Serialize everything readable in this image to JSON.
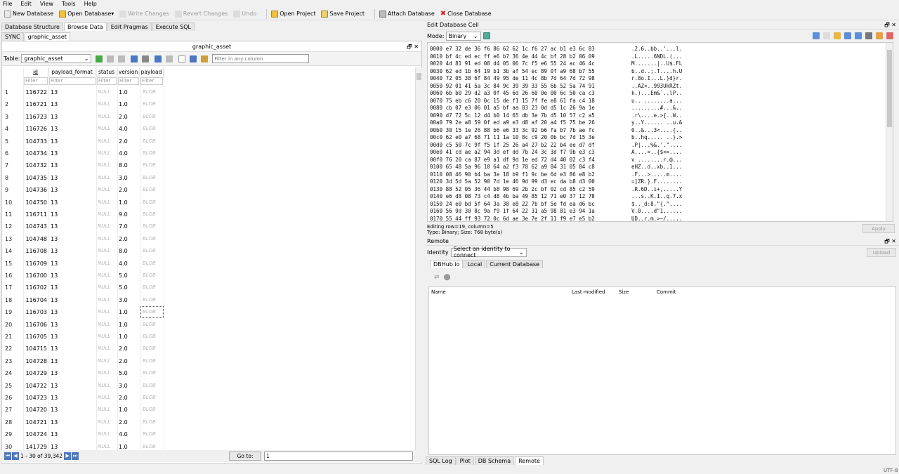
{
  "menu": [
    "File",
    "Edit",
    "View",
    "Tools",
    "Help"
  ],
  "toolbar": {
    "new_db": "New Database",
    "open_db": "Open Database",
    "write_changes": "Write Changes",
    "revert_changes": "Revert Changes",
    "undo": "Undo",
    "open_project": "Open Project",
    "save_project": "Save Project",
    "attach_db": "Attach Database",
    "close_db": "Close Database"
  },
  "main_tabs": [
    "Database Structure",
    "Browse Data",
    "Edit Pragmas",
    "Execute SQL"
  ],
  "sub_tabs": [
    "SYNC",
    "graphic_asset"
  ],
  "browse": {
    "title": "graphic_asset",
    "table_label": "Table:",
    "table_value": "graphic_asset",
    "filter_placeholder": "Filter in any column",
    "columns": [
      "id",
      "payload_format",
      "status",
      "version",
      "payload"
    ],
    "filter_text": "Filter",
    "rows": [
      {
        "n": "1",
        "id": "116722",
        "pf": "13",
        "st": "NULL",
        "ver": "1.0",
        "pl": "BLOB"
      },
      {
        "n": "2",
        "id": "116721",
        "pf": "13",
        "st": "NULL",
        "ver": "1.0",
        "pl": "BLOB"
      },
      {
        "n": "3",
        "id": "116723",
        "pf": "13",
        "st": "NULL",
        "ver": "2.0",
        "pl": "BLOB"
      },
      {
        "n": "4",
        "id": "116726",
        "pf": "13",
        "st": "NULL",
        "ver": "4.0",
        "pl": "BLOB"
      },
      {
        "n": "5",
        "id": "104733",
        "pf": "13",
        "st": "NULL",
        "ver": "2.0",
        "pl": "BLOB"
      },
      {
        "n": "6",
        "id": "104734",
        "pf": "13",
        "st": "NULL",
        "ver": "4.0",
        "pl": "BLOB"
      },
      {
        "n": "7",
        "id": "104732",
        "pf": "13",
        "st": "NULL",
        "ver": "8.0",
        "pl": "BLOB"
      },
      {
        "n": "8",
        "id": "104735",
        "pf": "13",
        "st": "NULL",
        "ver": "3.0",
        "pl": "BLOB"
      },
      {
        "n": "9",
        "id": "104736",
        "pf": "13",
        "st": "NULL",
        "ver": "2.0",
        "pl": "BLOB"
      },
      {
        "n": "10",
        "id": "104750",
        "pf": "13",
        "st": "NULL",
        "ver": "1.0",
        "pl": "BLOB"
      },
      {
        "n": "11",
        "id": "116711",
        "pf": "13",
        "st": "NULL",
        "ver": "9.0",
        "pl": "BLOB"
      },
      {
        "n": "12",
        "id": "104743",
        "pf": "13",
        "st": "NULL",
        "ver": "7.0",
        "pl": "BLOB"
      },
      {
        "n": "13",
        "id": "104748",
        "pf": "13",
        "st": "NULL",
        "ver": "2.0",
        "pl": "BLOB"
      },
      {
        "n": "14",
        "id": "116708",
        "pf": "13",
        "st": "NULL",
        "ver": "8.0",
        "pl": "BLOB"
      },
      {
        "n": "15",
        "id": "116709",
        "pf": "13",
        "st": "NULL",
        "ver": "4.0",
        "pl": "BLOB"
      },
      {
        "n": "16",
        "id": "116700",
        "pf": "13",
        "st": "NULL",
        "ver": "5.0",
        "pl": "BLOB"
      },
      {
        "n": "17",
        "id": "116702",
        "pf": "13",
        "st": "NULL",
        "ver": "5.0",
        "pl": "BLOB"
      },
      {
        "n": "18",
        "id": "116704",
        "pf": "13",
        "st": "NULL",
        "ver": "3.0",
        "pl": "BLOB"
      },
      {
        "n": "19",
        "id": "116703",
        "pf": "13",
        "st": "NULL",
        "ver": "1.0",
        "pl": "BLOB"
      },
      {
        "n": "20",
        "id": "116706",
        "pf": "13",
        "st": "NULL",
        "ver": "1.0",
        "pl": "BLOB"
      },
      {
        "n": "21",
        "id": "116705",
        "pf": "13",
        "st": "NULL",
        "ver": "1.0",
        "pl": "BLOB"
      },
      {
        "n": "22",
        "id": "104715",
        "pf": "13",
        "st": "NULL",
        "ver": "2.0",
        "pl": "BLOB"
      },
      {
        "n": "23",
        "id": "104728",
        "pf": "13",
        "st": "NULL",
        "ver": "2.0",
        "pl": "BLOB"
      },
      {
        "n": "24",
        "id": "104729",
        "pf": "13",
        "st": "NULL",
        "ver": "5.0",
        "pl": "BLOB"
      },
      {
        "n": "25",
        "id": "104722",
        "pf": "13",
        "st": "NULL",
        "ver": "3.0",
        "pl": "BLOB"
      },
      {
        "n": "26",
        "id": "104723",
        "pf": "13",
        "st": "NULL",
        "ver": "2.0",
        "pl": "BLOB"
      },
      {
        "n": "27",
        "id": "104720",
        "pf": "13",
        "st": "NULL",
        "ver": "1.0",
        "pl": "BLOB"
      },
      {
        "n": "28",
        "id": "104721",
        "pf": "13",
        "st": "NULL",
        "ver": "2.0",
        "pl": "BLOB"
      },
      {
        "n": "29",
        "id": "104724",
        "pf": "13",
        "st": "NULL",
        "ver": "4.0",
        "pl": "BLOB"
      },
      {
        "n": "30",
        "id": "141729",
        "pf": "13",
        "st": "NULL",
        "ver": "1.0",
        "pl": "BLOB"
      }
    ],
    "record_range": "1 - 30 of 39,342",
    "goto_label": "Go to:",
    "goto_value": "1"
  },
  "edit_cell": {
    "title": "Edit Database Cell",
    "mode_label": "Mode:",
    "mode_value": "Binary",
    "hex_lines": [
      {
        "off": "0000",
        "hex": "e7 32 de 36 f6 86 62 62 1c f6 27 ac b1 e3 6c 83",
        "asc": ".2.6..bb..'...l."
      },
      {
        "off": "0010",
        "hex": "bf 4c ed ec ff e6 b7 36 4e 44 4c bf 28 b2 06 09",
        "asc": ".L.....6NDL.(..."
      },
      {
        "off": "0020",
        "hex": "4d 81 91 ed 08 d4 05 06 7c f5 e6 55 24 ac 46 4c",
        "asc": "M.......|..U$.FL"
      },
      {
        "off": "0030",
        "hex": "62 ed 1b 64 19 b1 3b af 54 ec 89 0f a9 68 b7 55",
        "asc": "b..d..;.T....h.U"
      },
      {
        "off": "0040",
        "hex": "72 05 38 6f 84 49 95 de 11 4c 8b 7d 64 7d 72 98",
        "asc": "r.8o.I...L.}d}r."
      },
      {
        "off": "0050",
        "hex": "92 01 41 5a 3c 84 9c 39 39 33 55 6b 52 5a 74 91",
        "asc": "..AZ<..993UkRZt."
      },
      {
        "off": "0060",
        "hex": "6b b0 29 d2 a3 0f 45 6d 26 60 0e 00 6c 50 ca c3",
        "asc": "k.)...Em&`..lP.."
      },
      {
        "off": "0070",
        "hex": "75 eb c6 20 0c 15 de f1 15 7f fe e8 61 fa c4 18",
        "asc": "u.. ........a..."
      },
      {
        "off": "0080",
        "hex": "cb 07 e3 06 01 a5 bf aa 83 23 0d d5 1c 26 9a 1e",
        "asc": ".........#...&.."
      },
      {
        "off": "0090",
        "hex": "d7 72 5c 12 d4 b0 14 65 db 3e 7b d5 10 57 c2 a5",
        "asc": ".r\\....e.>{..W.."
      },
      {
        "off": "00a0",
        "hex": "79 2e a8 59 0f ed a9 e3 d8 af 20 a4 f5 75 be 26",
        "asc": "y..Y...... ..u.&"
      },
      {
        "off": "00b0",
        "hex": "30 15 1e 26 88 b6 e6 33 3c 92 b6 fa b7 7b ae fc",
        "asc": "0..&...3<....{.."
      },
      {
        "off": "00c0",
        "hex": "62 e0 a7 68 71 11 1a 10 8c c9 20 0b bc 7d 15 3e",
        "asc": "b..hq..... ..}.>"
      },
      {
        "off": "00d0",
        "hex": "c5 50 7c 9f f5 1f 25 26 a4 27 b2 22 b4 ee d7 df",
        "asc": ".P|...%&.'.\"...."
      },
      {
        "off": "00e0",
        "hex": "41 cd ae a2 94 3d ef dd 7b 24 3c 3d f7 9b e3 c3",
        "asc": "A....=..{$<=...."
      },
      {
        "off": "00f0",
        "hex": "76 20 ca 87 e9 a1 df 9d 1e ed 72 d4 40 02 c3 f4",
        "asc": "v ........r.@..."
      },
      {
        "off": "0100",
        "hex": "65 48 5a 96 10 64 a2 f3 78 62 a9 84 31 05 84 c8",
        "asc": "eHZ..d..xb..1..."
      },
      {
        "off": "0110",
        "hex": "08 46 90 b4 ba 3e 18 b9 f1 9c be 6d e3 86 e8 b2",
        "asc": ".F...>.....m...."
      },
      {
        "off": "0120",
        "hex": "3d 5d 5a 52 90 7d 1e 46 9d 99 d3 ec da b8 d3 00",
        "asc": "=]ZR.}.F........"
      },
      {
        "off": "0130",
        "hex": "88 52 05 36 44 b8 98 69 2b 2c bf 02 cd 85 c2 59",
        "asc": ".R.6D..i+,.....Y"
      },
      {
        "off": "0140",
        "hex": "e6 d8 08 73 c4 d8 4b ba 49 85 12 71 e0 37 12 78",
        "asc": "...s..K.I..q.7.x"
      },
      {
        "off": "0150",
        "hex": "24 e0 bd 5f 64 3a 38 e8 22 7b bf 5e fd ea d6 bc",
        "asc": "$.._d:8.\"{.^...."
      },
      {
        "off": "0160",
        "hex": "56 9d 30 8c 9a f9 1f 64 22 31 a5 98 81 e3 94 1a",
        "asc": "V.0....d\"1......"
      },
      {
        "off": "0170",
        "hex": "55 44 ff 93 72 0c 6d ae 3e 7e 2f 11 f9 e7 e5 b2",
        "asc": "UD..r.m.>~/....."
      }
    ],
    "editing_info": "Editing row=19, column=5",
    "type_info": "Type: Binary; Size: 768 byte(s)",
    "apply": "Apply"
  },
  "remote": {
    "title": "Remote",
    "identity_label": "Identity",
    "identity_value": "Select an identity to connect",
    "upload": "Upload",
    "tabs": [
      "DBHub.io",
      "Local",
      "Current Database"
    ],
    "columns": [
      "Name",
      "Last modified",
      "Size",
      "Commit"
    ]
  },
  "bottom_tabs": [
    "SQL Log",
    "Plot",
    "DB Schema",
    "Remote"
  ],
  "status_encoding": "UTF-8",
  "colors": {
    "accent": "#316ac5",
    "null_text": "#b8b8b8"
  }
}
